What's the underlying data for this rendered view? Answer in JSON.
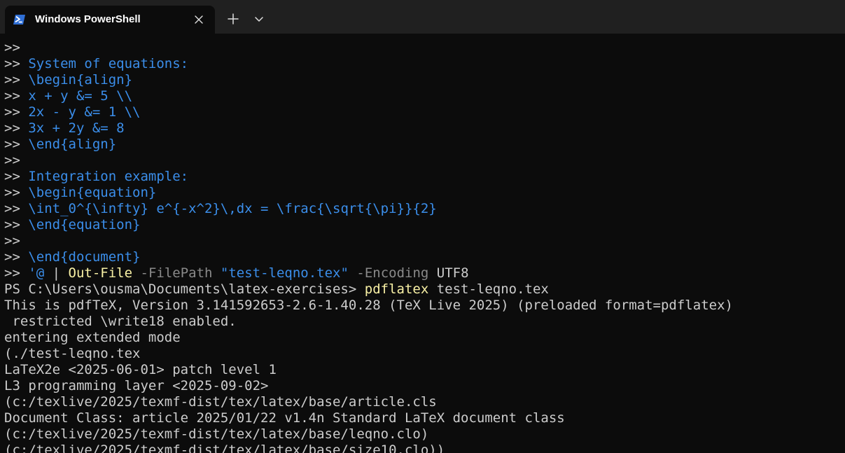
{
  "window": {
    "tab_title": "Windows PowerShell",
    "tab_icon": "powershell-icon",
    "close_icon": "close-icon",
    "new_tab_icon": "plus-icon",
    "dropdown_icon": "chevron-down-icon"
  },
  "colors": {
    "background": "#0c0c0c",
    "tabbar": "#202020",
    "default_text": "#cccccc",
    "string_text": "#3b8eea",
    "command_text": "#f9f1a5",
    "parameter_text": "#8a8a8a",
    "icon_blue": "#2f6fd6"
  },
  "terminal": {
    "lines": [
      [
        {
          "t": ">>",
          "c": "def"
        }
      ],
      [
        {
          "t": ">> ",
          "c": "def"
        },
        {
          "t": "System of equations:",
          "c": "str"
        }
      ],
      [
        {
          "t": ">> ",
          "c": "def"
        },
        {
          "t": "\\begin{align}",
          "c": "str"
        }
      ],
      [
        {
          "t": ">> ",
          "c": "def"
        },
        {
          "t": "x + y &= 5 \\\\",
          "c": "str"
        }
      ],
      [
        {
          "t": ">> ",
          "c": "def"
        },
        {
          "t": "2x - y &= 1 \\\\",
          "c": "str"
        }
      ],
      [
        {
          "t": ">> ",
          "c": "def"
        },
        {
          "t": "3x + 2y &= 8",
          "c": "str"
        }
      ],
      [
        {
          "t": ">> ",
          "c": "def"
        },
        {
          "t": "\\end{align}",
          "c": "str"
        }
      ],
      [
        {
          "t": ">>",
          "c": "def"
        }
      ],
      [
        {
          "t": ">> ",
          "c": "def"
        },
        {
          "t": "Integration example:",
          "c": "str"
        }
      ],
      [
        {
          "t": ">> ",
          "c": "def"
        },
        {
          "t": "\\begin{equation}",
          "c": "str"
        }
      ],
      [
        {
          "t": ">> ",
          "c": "def"
        },
        {
          "t": "\\int_0^{\\infty} e^{-x^2}\\,dx = \\frac{\\sqrt{\\pi}}{2}",
          "c": "str"
        }
      ],
      [
        {
          "t": ">> ",
          "c": "def"
        },
        {
          "t": "\\end{equation}",
          "c": "str"
        }
      ],
      [
        {
          "t": ">>",
          "c": "def"
        }
      ],
      [
        {
          "t": ">> ",
          "c": "def"
        },
        {
          "t": "\\end{document}",
          "c": "str"
        }
      ],
      [
        {
          "t": ">> ",
          "c": "def"
        },
        {
          "t": "'@",
          "c": "str"
        },
        {
          "t": " | ",
          "c": "def"
        },
        {
          "t": "Out-File",
          "c": "cmd"
        },
        {
          "t": " -FilePath ",
          "c": "par"
        },
        {
          "t": "\"test-leqno.tex\"",
          "c": "str"
        },
        {
          "t": " -Encoding ",
          "c": "par"
        },
        {
          "t": "UTF8",
          "c": "def"
        }
      ],
      [
        {
          "t": "PS C:\\Users\\ousma\\Documents\\latex-exercises> ",
          "c": "def"
        },
        {
          "t": "pdflatex",
          "c": "cmd"
        },
        {
          "t": " test-leqno.tex",
          "c": "def"
        }
      ],
      [
        {
          "t": "This is pdfTeX, Version 3.141592653-2.6-1.40.28 (TeX Live 2025) (preloaded format=pdflatex)",
          "c": "def"
        }
      ],
      [
        {
          "t": " restricted \\write18 enabled.",
          "c": "def"
        }
      ],
      [
        {
          "t": "entering extended mode",
          "c": "def"
        }
      ],
      [
        {
          "t": "(./test-leqno.tex",
          "c": "def"
        }
      ],
      [
        {
          "t": "LaTeX2e <2025-06-01> patch level 1",
          "c": "def"
        }
      ],
      [
        {
          "t": "L3 programming layer <2025-09-02>",
          "c": "def"
        }
      ],
      [
        {
          "t": "(c:/texlive/2025/texmf-dist/tex/latex/base/article.cls",
          "c": "def"
        }
      ],
      [
        {
          "t": "Document Class: article 2025/01/22 v1.4n Standard LaTeX document class",
          "c": "def"
        }
      ],
      [
        {
          "t": "(c:/texlive/2025/texmf-dist/tex/latex/base/leqno.clo)",
          "c": "def"
        }
      ],
      [
        {
          "t": "(c:/texlive/2025/texmf-dist/tex/latex/base/size10.clo))",
          "c": "def"
        }
      ]
    ]
  }
}
